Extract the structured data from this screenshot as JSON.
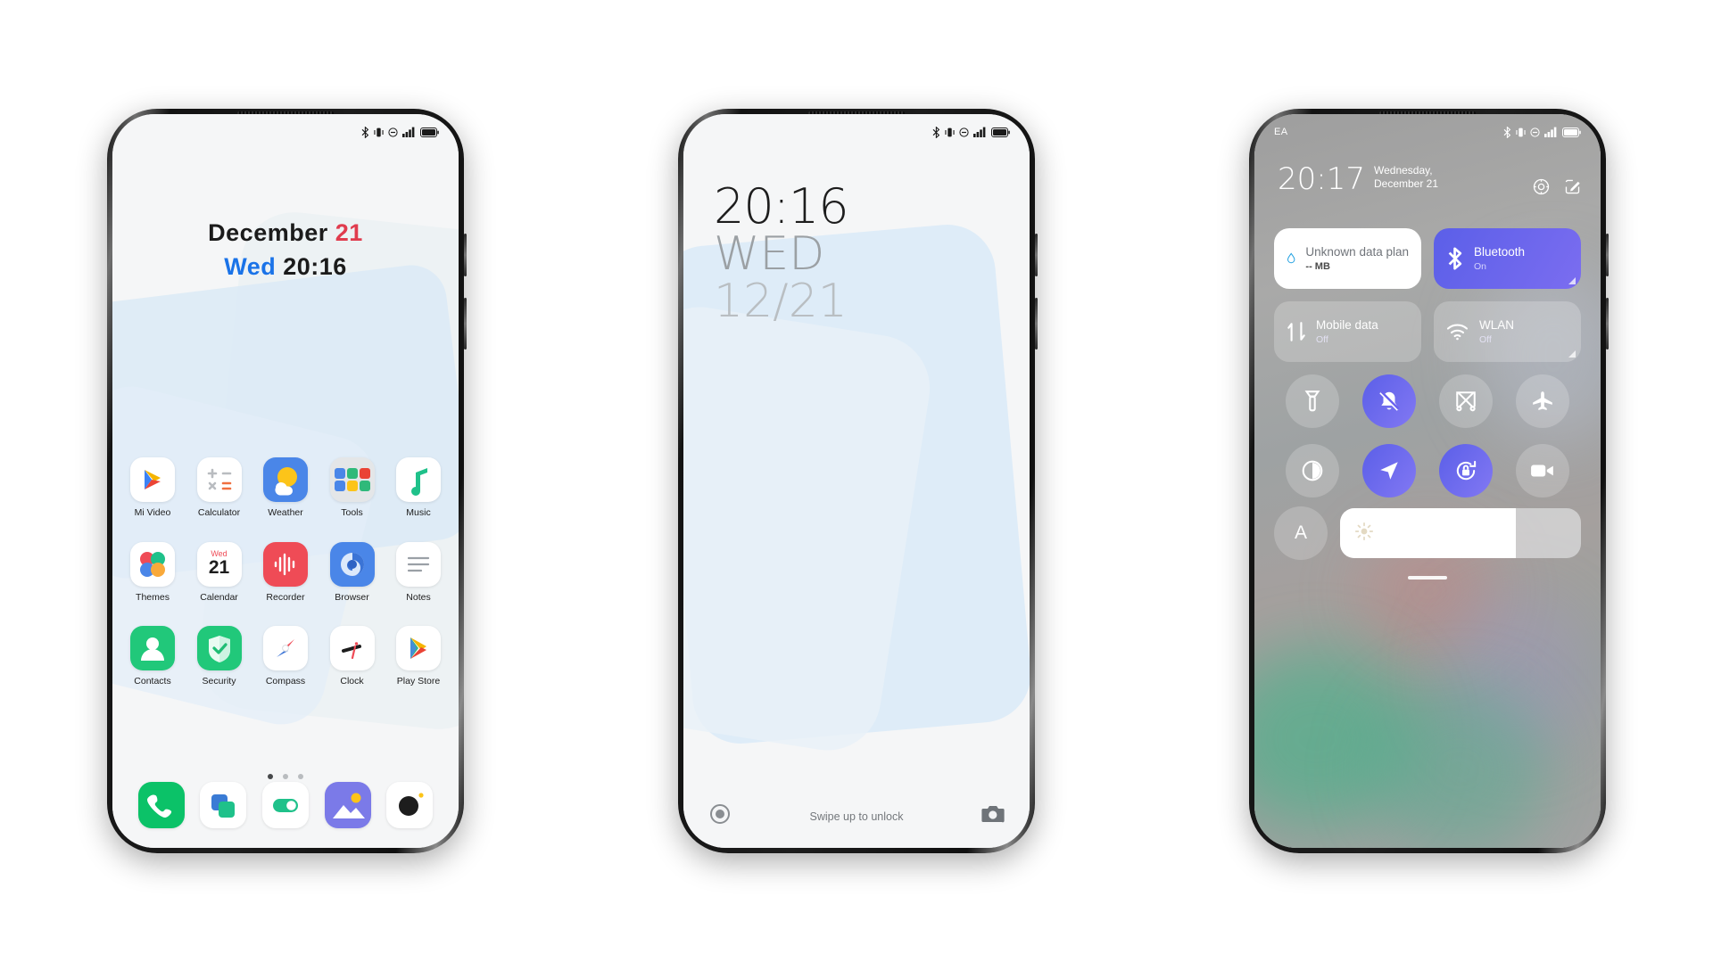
{
  "phones": [
    {
      "id": "home-screen",
      "status_bar": {
        "carrier": "",
        "icons": [
          "bluetooth-icon",
          "vibrate-icon",
          "dnd-icon",
          "signal-icon",
          "battery-icon"
        ]
      },
      "clock_widget": {
        "month": "December",
        "day": "21",
        "weekday": "Wed",
        "time": "20:16"
      },
      "app_rows": [
        [
          {
            "label": "Mi Video",
            "icon": "mi-video-icon"
          },
          {
            "label": "Calculator",
            "icon": "calculator-icon"
          },
          {
            "label": "Weather",
            "icon": "weather-icon"
          },
          {
            "label": "Tools",
            "icon": "tools-folder-icon"
          },
          {
            "label": "Music",
            "icon": "music-icon"
          }
        ],
        [
          {
            "label": "Themes",
            "icon": "themes-icon"
          },
          {
            "label": "Calendar",
            "icon": "calendar-icon",
            "badge_weekday": "Wed",
            "badge_day": "21"
          },
          {
            "label": "Recorder",
            "icon": "recorder-icon"
          },
          {
            "label": "Browser",
            "icon": "browser-icon"
          },
          {
            "label": "Notes",
            "icon": "notes-icon"
          }
        ],
        [
          {
            "label": "Contacts",
            "icon": "contacts-icon"
          },
          {
            "label": "Security",
            "icon": "security-icon"
          },
          {
            "label": "Compass",
            "icon": "compass-icon"
          },
          {
            "label": "Clock",
            "icon": "clock-icon"
          },
          {
            "label": "Play Store",
            "icon": "play-store-icon"
          }
        ]
      ],
      "page_indicator": {
        "pages": 3,
        "active": 1
      },
      "dock": [
        {
          "label": "Phone",
          "icon": "phone-icon"
        },
        {
          "label": "Messages",
          "icon": "messages-icon"
        },
        {
          "label": "Settings",
          "icon": "settings-icon"
        },
        {
          "label": "Gallery",
          "icon": "gallery-icon"
        },
        {
          "label": "Camera",
          "icon": "camera-icon"
        }
      ]
    },
    {
      "id": "lock-screen",
      "status_bar": {
        "carrier": "",
        "icons": [
          "bluetooth-icon",
          "vibrate-icon",
          "dnd-icon",
          "signal-icon",
          "battery-icon"
        ]
      },
      "lock_clock": {
        "time": "20:16",
        "weekday": "WED",
        "date": "12/21"
      },
      "bottom_bar": {
        "left_icon": "assistant-icon",
        "hint": "Swipe up to unlock",
        "right_icon": "camera-icon"
      }
    },
    {
      "id": "control-center",
      "status_bar": {
        "carrier": "EA",
        "icons": [
          "bluetooth-icon",
          "vibrate-icon",
          "dnd-icon",
          "signal-icon",
          "battery-icon"
        ]
      },
      "header": {
        "time": "20:17",
        "date": "Wednesday, December 21",
        "icons": [
          "settings-gear-icon",
          "edit-icon"
        ]
      },
      "tiles": [
        {
          "title": "Unknown data plan",
          "subtitle": "-- MB",
          "state": "light",
          "icon": "data-drop-icon",
          "expandable": false
        },
        {
          "title": "Bluetooth",
          "subtitle": "On",
          "state": "active",
          "icon": "bluetooth-icon",
          "expandable": true
        },
        {
          "title": "Mobile data",
          "subtitle": "Off",
          "state": "dim",
          "icon": "mobile-data-icon",
          "expandable": false
        },
        {
          "title": "WLAN",
          "subtitle": "Off",
          "state": "dim",
          "icon": "wlan-icon",
          "expandable": true
        }
      ],
      "toggles": [
        {
          "name": "flashlight-icon",
          "on": false
        },
        {
          "name": "silent-mode-icon",
          "on": true
        },
        {
          "name": "cast-screenshot-icon",
          "on": false
        },
        {
          "name": "airplane-mode-icon",
          "on": false
        },
        {
          "name": "dark-mode-icon",
          "on": false
        },
        {
          "name": "location-icon",
          "on": true
        },
        {
          "name": "rotation-lock-icon",
          "on": true
        },
        {
          "name": "screen-recorder-icon",
          "on": false
        }
      ],
      "brightness": {
        "auto_label": "A",
        "value": 73,
        "icon": "sun-icon"
      }
    }
  ],
  "colors": {
    "accent_blue": "#1a73e8",
    "accent_red": "#e03c4e",
    "tile_active": "#5b5fe8",
    "wallpaper": "#f5f6f7"
  }
}
